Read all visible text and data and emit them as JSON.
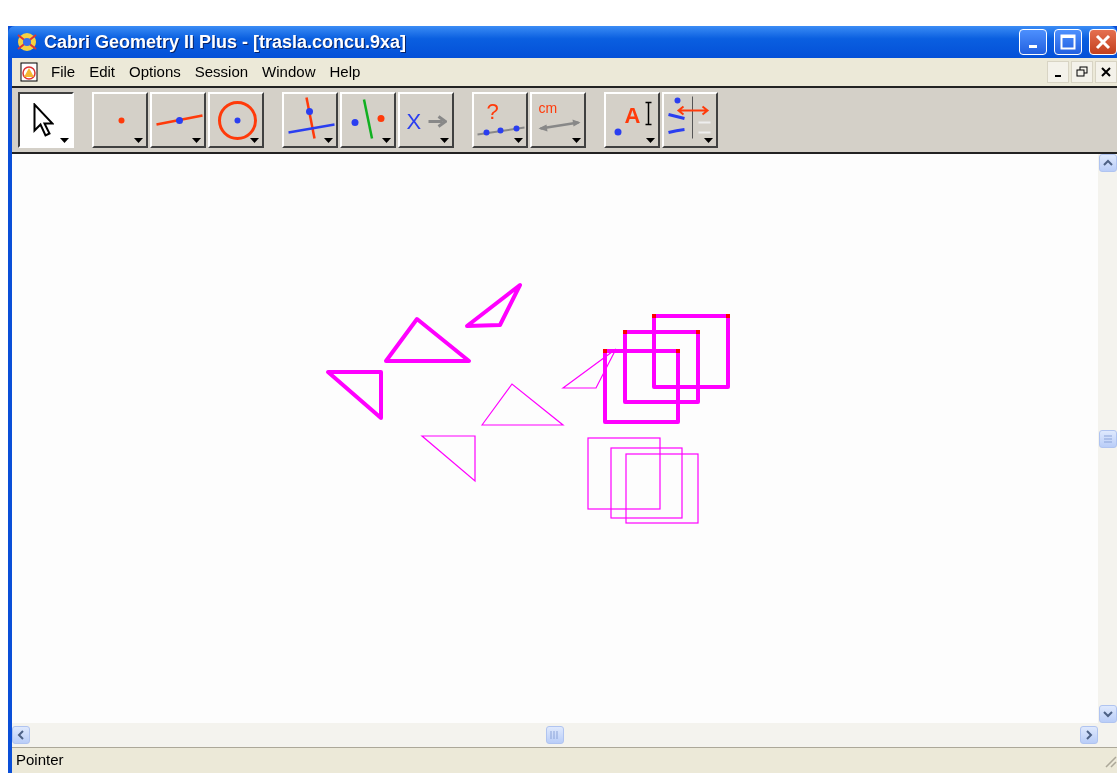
{
  "window": {
    "title": "Cabri Geometry II Plus - [trasla.concu.9xa]"
  },
  "menu": [
    "File",
    "Edit",
    "Options",
    "Session",
    "Window",
    "Help"
  ],
  "toolbar_groups": [
    [
      {
        "kind": "pointer",
        "selected": true
      }
    ],
    [
      {
        "kind": "point",
        "selected": false
      },
      {
        "kind": "line",
        "selected": false
      },
      {
        "kind": "circle",
        "selected": false
      }
    ],
    [
      {
        "kind": "perpendicular",
        "selected": false
      },
      {
        "kind": "symmetry",
        "selected": false
      },
      {
        "kind": "transform",
        "selected": false,
        "glyph": "X"
      }
    ],
    [
      {
        "kind": "check",
        "selected": false,
        "glyph": "?"
      },
      {
        "kind": "measure",
        "selected": false,
        "glyph": "cm"
      }
    ],
    [
      {
        "kind": "text",
        "selected": false,
        "glyph": "A"
      },
      {
        "kind": "attributes",
        "selected": false
      }
    ]
  ],
  "status_bar": "Pointer"
}
